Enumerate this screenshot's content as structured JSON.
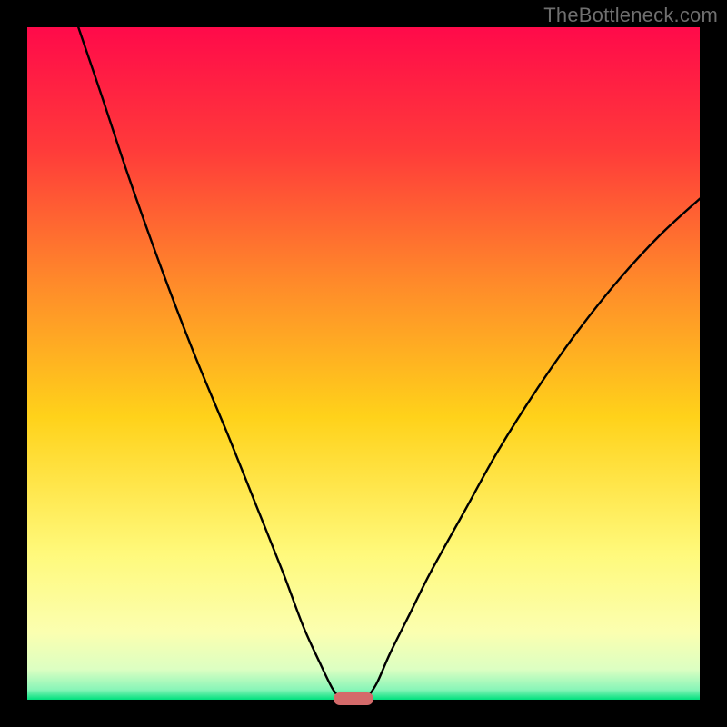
{
  "watermark": "TheBottleneck.com",
  "chart_data": {
    "type": "line",
    "title": "",
    "xlabel": "",
    "ylabel": "",
    "xlim": [
      0,
      100
    ],
    "ylim": [
      0,
      100
    ],
    "background_gradient": {
      "direction": "top-to-bottom",
      "stops": [
        {
          "offset": 0.0,
          "color": "#ff0a4a"
        },
        {
          "offset": 0.18,
          "color": "#ff3a3a"
        },
        {
          "offset": 0.38,
          "color": "#ff8a2a"
        },
        {
          "offset": 0.58,
          "color": "#ffd21a"
        },
        {
          "offset": 0.78,
          "color": "#fff97a"
        },
        {
          "offset": 0.9,
          "color": "#fbffb0"
        },
        {
          "offset": 0.955,
          "color": "#dcffc2"
        },
        {
          "offset": 0.985,
          "color": "#88f5b8"
        },
        {
          "offset": 1.0,
          "color": "#00e07e"
        }
      ]
    },
    "series": [
      {
        "name": "left-branch",
        "x": [
          7.6,
          11,
          15,
          20,
          25,
          30,
          34,
          38,
          41,
          43.5,
          45.3,
          46.5
        ],
        "y": [
          100,
          90,
          78,
          64,
          51,
          39,
          29,
          19,
          11,
          5.5,
          1.8,
          0.2
        ]
      },
      {
        "name": "right-branch",
        "x": [
          50.5,
          52,
          54,
          57,
          60,
          65,
          70,
          76,
          82,
          88,
          94,
          100
        ],
        "y": [
          0.2,
          2.5,
          7,
          13,
          19,
          28,
          37,
          46.5,
          55,
          62.5,
          69,
          74.5
        ]
      }
    ],
    "annotations": [
      {
        "name": "valley-marker",
        "type": "rounded-rect",
        "x_start": 45.5,
        "x_end": 51.5,
        "y": 0,
        "color": "#d46a6a"
      }
    ]
  }
}
